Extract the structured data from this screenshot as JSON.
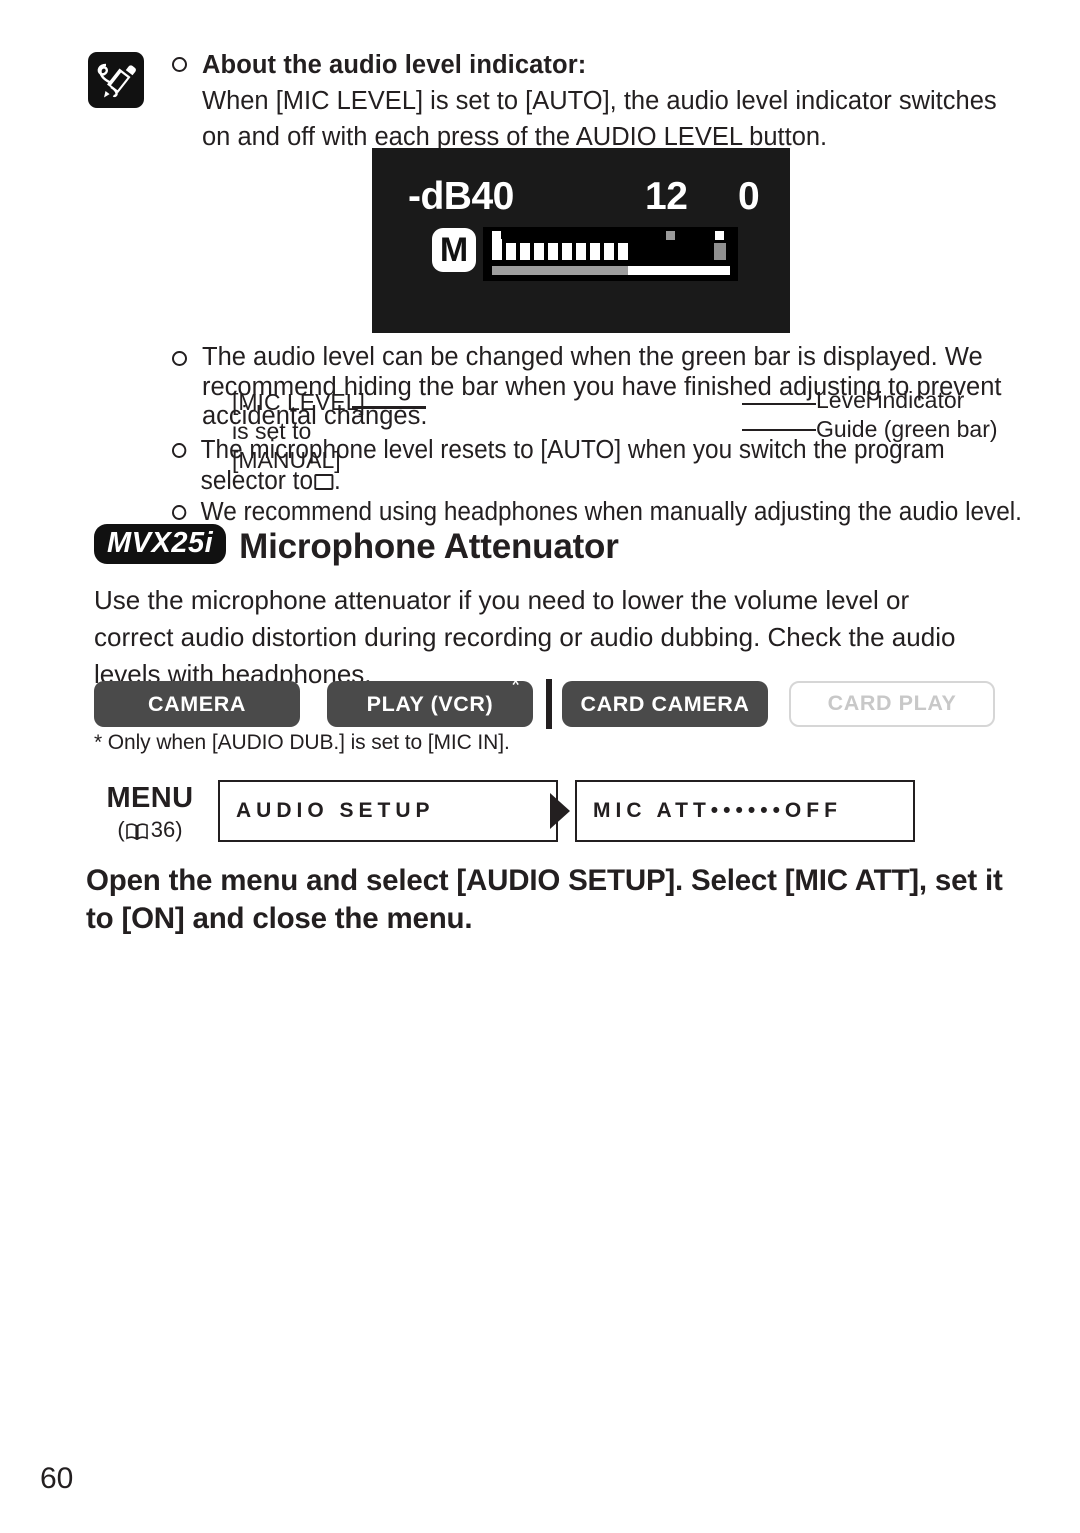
{
  "note": {
    "icon": "note-pencil-icon",
    "bullet_symbol": "○",
    "title": "About the audio level indicator:",
    "text": "When [MIC LEVEL] is set to [AUTO], the audio level indicator switches on and off with each press of the AUDIO LEVEL button."
  },
  "figure": {
    "lcd": {
      "scale_left": "-dB40",
      "scale_mid": "12",
      "scale_right": "0",
      "mode_badge": "M",
      "segment_count": 10,
      "guide_fill_percent": 57,
      "background_color": "#1a1a1a",
      "meter_background": "#000000"
    },
    "callout_left_lines": [
      "[MIC LEVEL]",
      "is set to",
      "[MANUAL]"
    ],
    "callout_right_lines": [
      "Level indicator",
      "Guide (green bar)"
    ]
  },
  "bullets": [
    {
      "symbol": "○",
      "text": "The audio level can be changed when the green bar is displayed. We recommend hiding the bar when you have finished adjusting to prevent accidental changes."
    },
    {
      "symbol": "○",
      "text_before": "The microphone level resets to [AUTO] when you switch the program selector to",
      "symbol_inline": "program-auto-rectangle",
      "text_after": "."
    },
    {
      "symbol": "○",
      "text": "We recommend using headphones when manually adjusting the audio level."
    }
  ],
  "section": {
    "model_badge": "MVX25i",
    "title": "Microphone Attenuator",
    "rule_color": "#c3d0d2",
    "body": "Use the microphone attenuator if you need to lower the volume level or correct audio distortion during recording or audio dubbing. Check the audio levels with headphones."
  },
  "modes": {
    "buttons": [
      {
        "label": "CAMERA",
        "state": "on"
      },
      {
        "label": "PLAY (VCR)",
        "state": "on",
        "asterisk": "*"
      },
      {
        "label": "CARD CAMERA",
        "state": "on"
      },
      {
        "label": "CARD PLAY",
        "state": "off"
      }
    ],
    "footnote": "* Only when [AUDIO DUB.] is set to [MIC IN]."
  },
  "menu": {
    "label": "MENU",
    "page_ref_open": "(",
    "page_ref_icon": "book-icon",
    "page_ref_number": "36",
    "page_ref_close": ")",
    "box1": "AUDIO SETUP",
    "arrow_icon": "play-arrow-icon",
    "box2": "MIC ATT••••••OFF"
  },
  "instruction": "Open the menu and select [AUDIO SETUP]. Select [MIC ATT], set it to [ON] and close the menu.",
  "page_number": "60"
}
